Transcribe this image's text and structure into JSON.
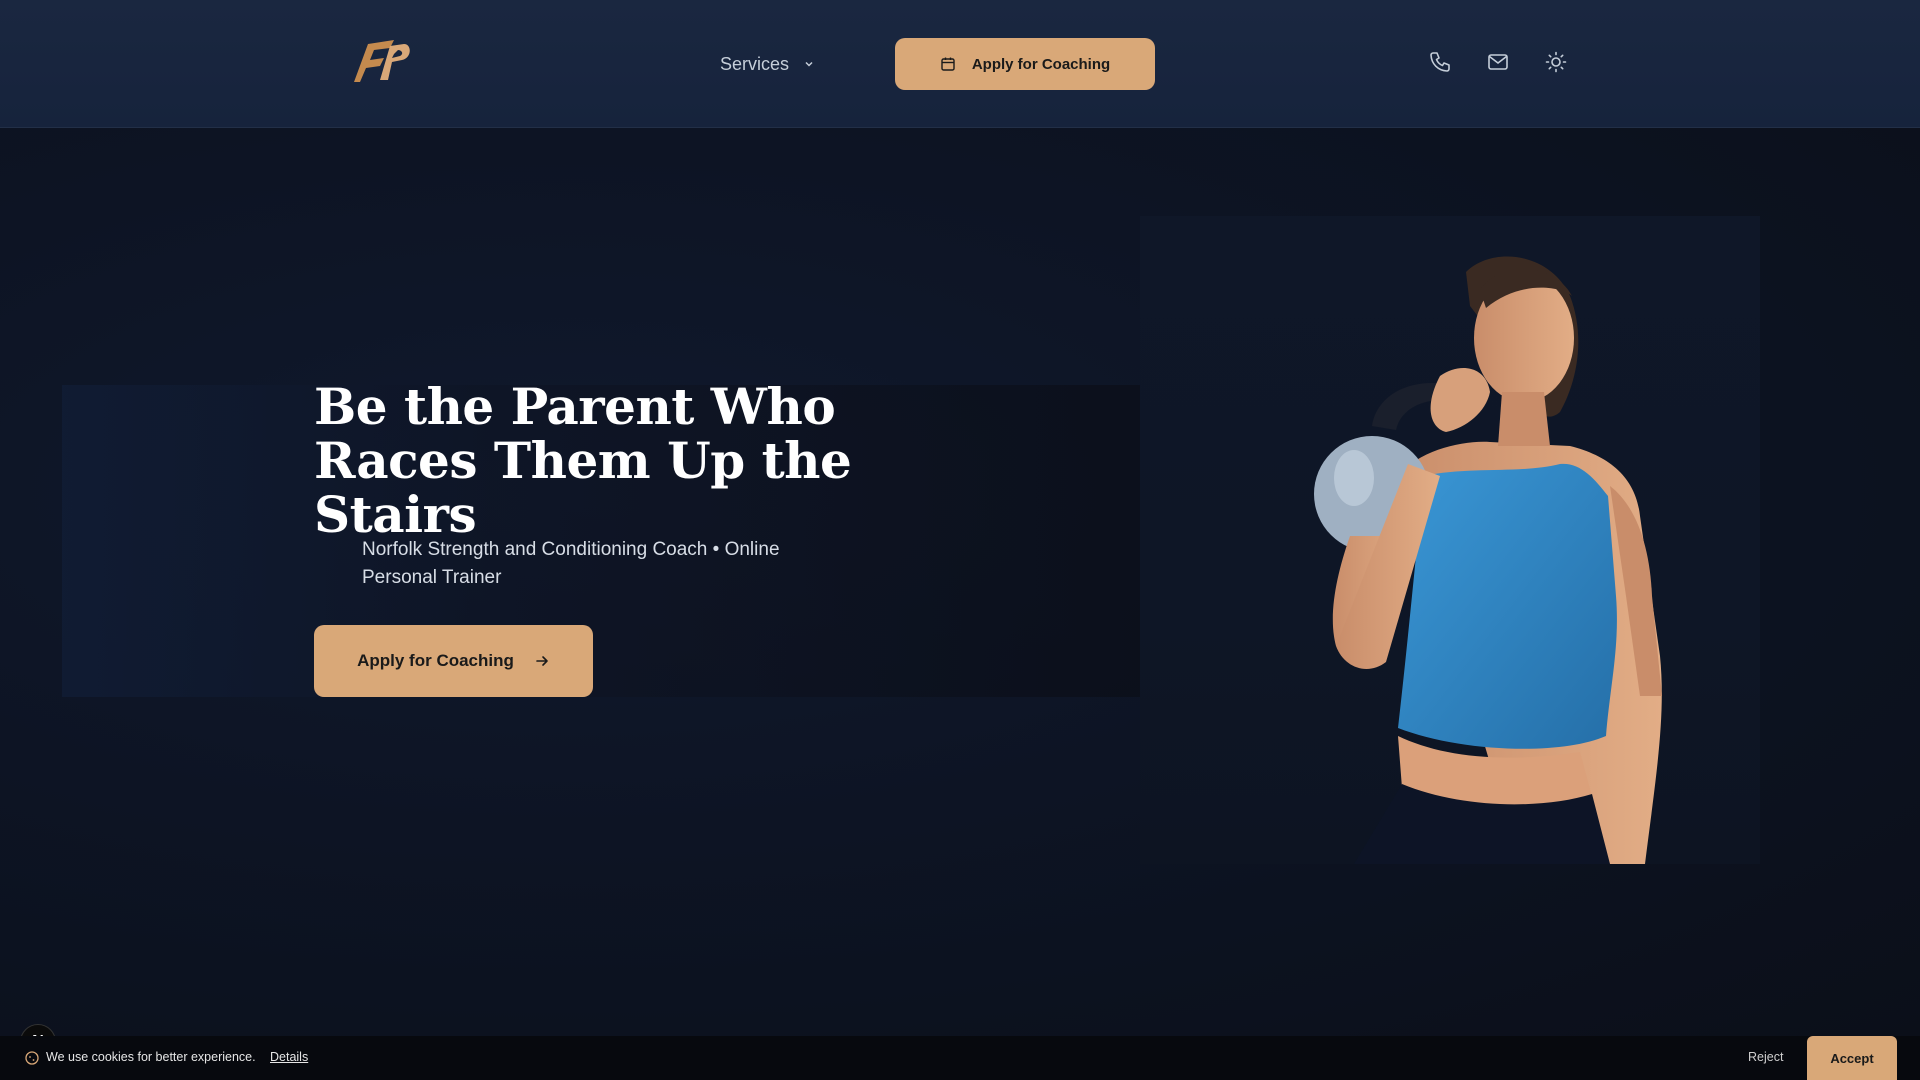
{
  "header": {
    "logo_icon": "logo-icon",
    "services_label": "Services",
    "cta_label": "Apply for Coaching",
    "cta_icon": "calendar-icon",
    "icons": [
      "phone-icon",
      "mail-icon",
      "sun-icon"
    ]
  },
  "hero": {
    "title": "Be the Parent Who Races Them Up the Stairs",
    "subtitle": "Norfolk Strength and Conditioning Coach • Online Personal Trainer",
    "cta_label": "Apply for Coaching",
    "cta_icon": "arrow-right-icon"
  },
  "cookie": {
    "text": "We use cookies for better experience.",
    "details_label": "Details",
    "reject_label": "Reject",
    "accept_label": "Accept"
  },
  "badge": {
    "letter": "N"
  },
  "colors": {
    "accent": "#d9a878",
    "header_bg": "#1a2740",
    "hero_bg": "#0d1424",
    "shirt_blue": "#2f86c4"
  }
}
